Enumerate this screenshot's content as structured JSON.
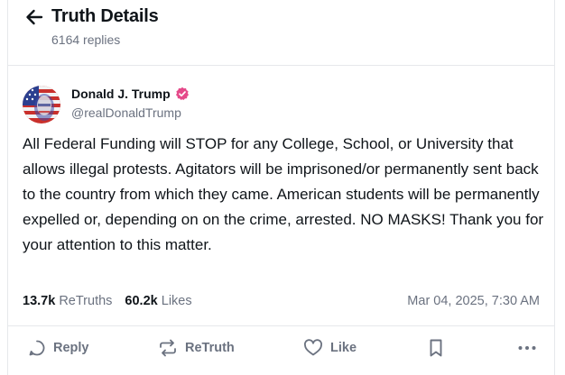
{
  "header": {
    "title": "Truth Details",
    "replies": "6164 replies"
  },
  "author": {
    "name": "Donald J. Trump",
    "handle": "@realDonaldTrump",
    "verified": true
  },
  "post": {
    "text": "All Federal Funding will STOP for any College, School, or University that allows illegal protests. Agitators will be imprisoned/or permanently sent back to the country from which they came. American students will be permanently expelled or, depending on on the crime, arrested. NO MASKS! Thank you for your attention to this matter."
  },
  "stats": {
    "retruths_count": "13.7k",
    "retruths_label": "ReTruths",
    "likes_count": "60.2k",
    "likes_label": "Likes",
    "timestamp": "Mar 04, 2025, 7:30 AM"
  },
  "actions": {
    "reply": "Reply",
    "retruth": "ReTruth",
    "like": "Like"
  },
  "colors": {
    "verified": "#e5498a",
    "muted": "#6b7280",
    "text": "#0f1419"
  }
}
